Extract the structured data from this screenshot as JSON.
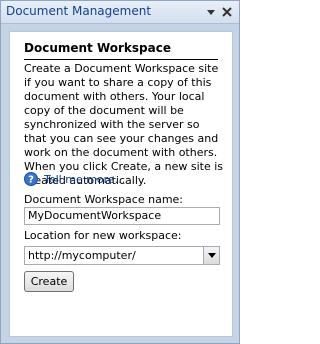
{
  "pane": {
    "title": "Document Management",
    "icons": {
      "dropdown": "chevron-down-icon",
      "close": "close-icon"
    }
  },
  "workspace": {
    "heading": "Document Workspace",
    "description": "Create a Document Workspace site if you want to share a copy of this document with others. Your local copy of the document will be synchronized with the server so that you can see your changes and work on the document with others. When you click Create, a new site is created automatically.",
    "help_link": "Tell me more...",
    "help_icon": "help-icon",
    "name_label": "Document Workspace name:",
    "name_value": "MyDocumentWorkspace",
    "location_label": "Location for new workspace:",
    "location_value": "http://mycomputer/",
    "create_button": "Create"
  },
  "colors": {
    "pane_background": "#c6d3e4",
    "title_text": "#15428b",
    "link_text": "#0b3d91",
    "help_icon": "#3a74c9"
  }
}
